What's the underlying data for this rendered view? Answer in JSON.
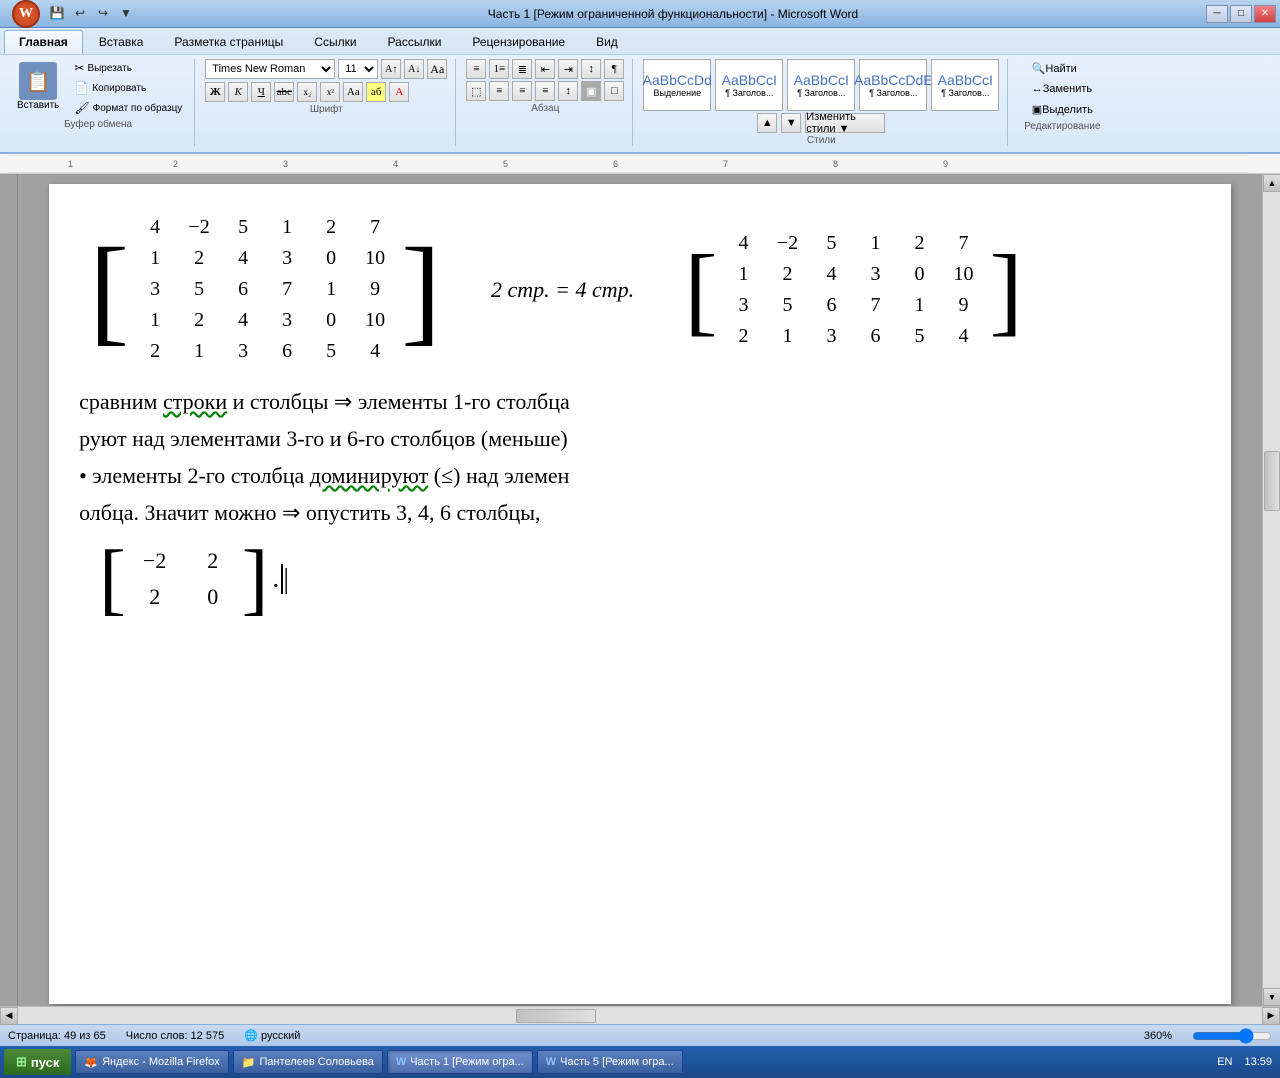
{
  "titlebar": {
    "title": "Часть 1 [Режим ограниченной функциональности] - Microsoft Word",
    "minimize": "─",
    "restore": "□",
    "close": "✕"
  },
  "ribbon": {
    "tabs": [
      "Главная",
      "Вставка",
      "Разметка страницы",
      "Ссылки",
      "Рассылки",
      "Рецензирование",
      "Вид"
    ],
    "active_tab": "Главная",
    "font_name": "Times New Roman",
    "font_size": "11",
    "groups": {
      "clipboard": "Буфер обмена",
      "font": "Шрифт",
      "paragraph": "Абзац",
      "styles": "Стили",
      "editing": "Редактирование"
    },
    "clipboard_buttons": [
      "Вставить",
      "Вырезать",
      "Копировать",
      "Формат по образцу"
    ],
    "editing_buttons": [
      "Найти",
      "Заменить",
      "Выделить"
    ]
  },
  "matrix1": {
    "rows": [
      [
        "4",
        "−2",
        "5",
        "1",
        "2",
        "7"
      ],
      [
        "1",
        "2",
        "4",
        "3",
        "0",
        "10"
      ],
      [
        "3",
        "5",
        "6",
        "7",
        "1",
        "9"
      ],
      [
        "1",
        "2",
        "4",
        "3",
        "0",
        "10"
      ],
      [
        "2",
        "1",
        "3",
        "6",
        "5",
        "4"
      ]
    ]
  },
  "matrix_label": "2 стр. = 4 стр.",
  "matrix2": {
    "rows": [
      [
        "4",
        "−2",
        "5",
        "1",
        "2",
        "7"
      ],
      [
        "1",
        "2",
        "4",
        "3",
        "0",
        "10"
      ],
      [
        "3",
        "5",
        "6",
        "7",
        "1",
        "9"
      ],
      [
        "2",
        "1",
        "3",
        "6",
        "5",
        "4"
      ]
    ]
  },
  "text_lines": [
    "сравним строки и столбцы ⇒ элементы 1-го столбца",
    "руют над элементами 3-го и 6-го столбцов (меньше)",
    "• элементы 2-го столбца доминируют (≤) над элемен",
    "олбца. Значит можно ⇒ опустить 3, 4, 6 столбцы,"
  ],
  "small_matrix": {
    "rows": [
      [
        "−2",
        "2"
      ],
      [
        "2",
        "0"
      ]
    ]
  },
  "statusbar": {
    "page": "Страница: 49 из 65",
    "words": "Число слов: 12 575",
    "lang": "русский",
    "zoom": "360%"
  },
  "taskbar": {
    "start": "пуск",
    "items": [
      {
        "label": "Яндекс - Mozilla Firefox",
        "icon": "🦊"
      },
      {
        "label": "Пантелеев Соловьева",
        "icon": "📁"
      },
      {
        "label": "Часть 1 [Режим огра...",
        "icon": "W"
      },
      {
        "label": "Часть 5 [Режим огра...",
        "icon": "W"
      }
    ],
    "lang": "EN",
    "time": "13:59"
  }
}
